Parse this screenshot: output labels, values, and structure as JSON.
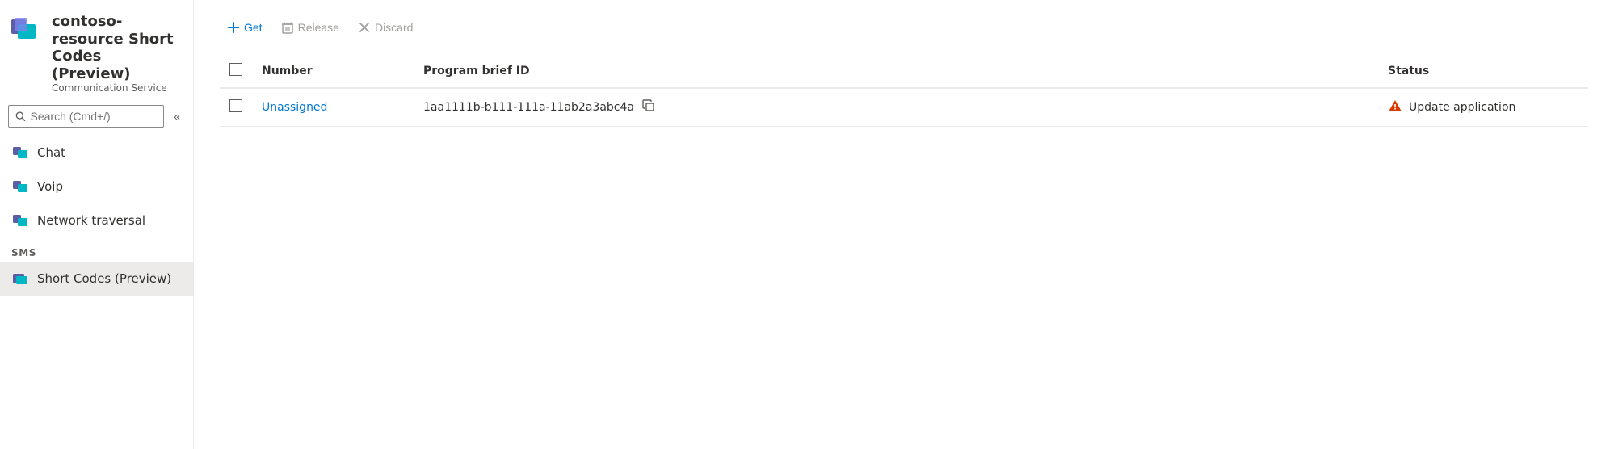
{
  "app": {
    "title": "contoso-resource Short Codes (Preview)",
    "subtitle": "Communication Service",
    "more_label": "···"
  },
  "sidebar": {
    "search_placeholder": "Search (Cmd+/)",
    "collapse_label": "«",
    "nav_items": [
      {
        "id": "chat",
        "label": "Chat"
      },
      {
        "id": "voip",
        "label": "Voip"
      },
      {
        "id": "network-traversal",
        "label": "Network traversal"
      }
    ],
    "sms_section_label": "SMS",
    "sms_items": [
      {
        "id": "short-codes",
        "label": "Short Codes (Preview)",
        "active": true
      }
    ]
  },
  "toolbar": {
    "get_label": "Get",
    "release_label": "Release",
    "discard_label": "Discard"
  },
  "table": {
    "columns": [
      "Number",
      "Program brief ID",
      "Status"
    ],
    "rows": [
      {
        "number": "Unassigned",
        "program_id": "1aa1111b-b111-111a-11ab2a3abc4a",
        "status": "Update application"
      }
    ]
  }
}
